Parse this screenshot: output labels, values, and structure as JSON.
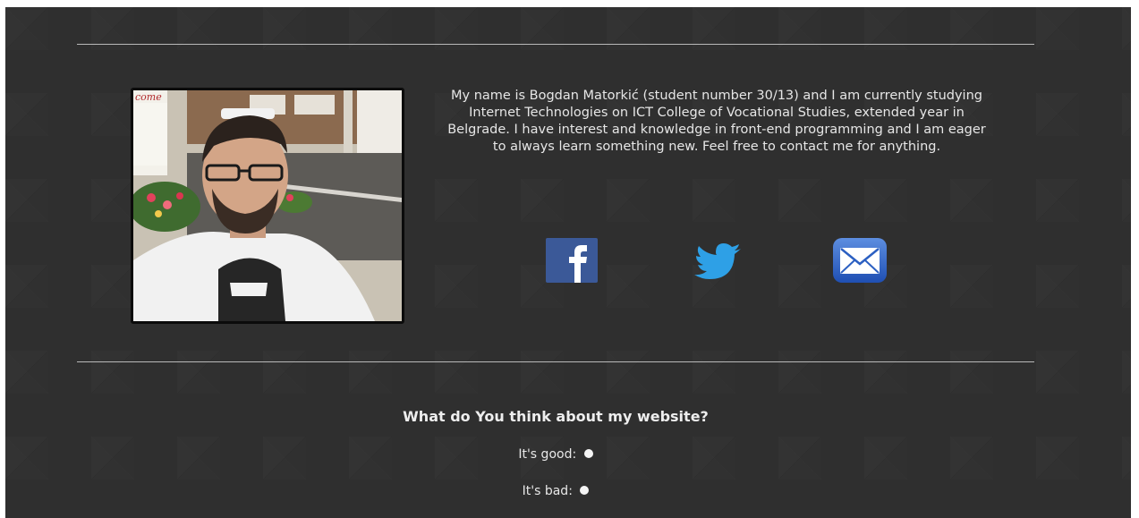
{
  "profile": {
    "photo_alt": "Profile photo",
    "bio": "My name is Bogdan Matorkić (student number 30/13) and I am currently studying Internet Technologies on ICT College of Vocational Studies, extended year in Belgrade. I have interest and knowledge in front-end programming and I am eager to always learn something new. Feel free to contact me for anything."
  },
  "social": [
    {
      "name": "facebook",
      "icon": "facebook-icon",
      "color": "#3b5998"
    },
    {
      "name": "twitter",
      "icon": "twitter-bird-icon",
      "color": "#1da1f2"
    },
    {
      "name": "email",
      "icon": "envelope-icon",
      "color": "#2f66c7"
    }
  ],
  "poll": {
    "question": "What do You think about my website?",
    "options": [
      {
        "label": "It's good:"
      },
      {
        "label": "It's bad:"
      }
    ]
  },
  "colors": {
    "background": "#2f2f2f",
    "text": "#e6e6e6",
    "rule": "#b9b9b9"
  }
}
